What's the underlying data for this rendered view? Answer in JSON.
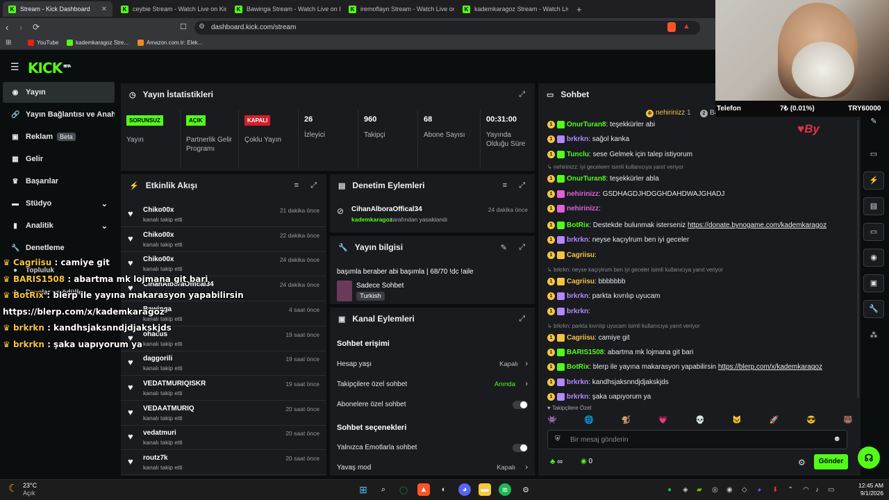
{
  "browser": {
    "tabs": [
      {
        "title": "Stream - Kick Dashboard",
        "active": true
      },
      {
        "title": "ceybie Stream - Watch Live on Kick"
      },
      {
        "title": "Bawinga Stream - Watch Live on Kick"
      },
      {
        "title": "iremoflayn Stream - Watch Live on Kick"
      },
      {
        "title": "kademkaragoz Stream - Watch Live on Kick"
      }
    ],
    "new_tab": "+",
    "url": "dashboard.kick.com/stream",
    "bookmarks": [
      "YouTube",
      "kademkaragoz Stre...",
      "Amazon.com.tr: Elek..."
    ]
  },
  "app": {
    "logo": "KICK",
    "logo_tag": "BETA",
    "sidebar": [
      {
        "label": "Yayın",
        "icon": "broadcast-icon",
        "active": true
      },
      {
        "label": "Yayın Bağlantısı ve Anahtarı",
        "icon": "link-icon"
      },
      {
        "label": "Reklam",
        "icon": "ad-icon",
        "badge": "Beta"
      },
      {
        "label": "Gelir",
        "icon": "revenue-icon"
      },
      {
        "label": "Başarılar",
        "icon": "trophy-icon"
      },
      {
        "label": "Stüdyo",
        "icon": "studio-icon",
        "chevron": true
      },
      {
        "label": "Analitik",
        "icon": "analytics-icon",
        "chevron": true
      },
      {
        "label": "Denetleme",
        "icon": "moderation-icon"
      },
      {
        "label": "Topluluk",
        "icon": "community-icon"
      },
      {
        "label": "Droplar ve ödüller",
        "icon": "drops-icon"
      }
    ]
  },
  "stats": {
    "title": "Yayın İstatistikleri",
    "items": [
      {
        "tag": "SORUNSUZ",
        "tag_color": "#53fc18",
        "label": "Yayın"
      },
      {
        "tag": "AÇIK",
        "tag_color": "#53fc18",
        "label": "Partnerlik Gelir Programı"
      },
      {
        "tag": "KAPALI",
        "tag_color": "#d0202a",
        "label": "Çoklu Yayın"
      },
      {
        "value": "26",
        "label": "İzleyici"
      },
      {
        "value": "960",
        "label": "Takipçi"
      },
      {
        "value": "68",
        "label": "Abone Sayısı"
      },
      {
        "value": "00:31:00",
        "label": "Yayında Olduğu Süre"
      }
    ]
  },
  "activity": {
    "title": "Etkinlik Akışı",
    "items": [
      {
        "name": "Chiko00x",
        "sub": "kanalı takip etti",
        "time": "21 dakika önce"
      },
      {
        "name": "Chiko00x",
        "sub": "kanalı takip etti",
        "time": "22 dakika önce"
      },
      {
        "name": "Chiko00x",
        "sub": "kanalı takip etti",
        "time": "24 dakika önce"
      },
      {
        "name": "CihanAlboraOffical34",
        "sub": "kanalı takip etti",
        "time": "24 dakika önce"
      },
      {
        "name": "Bawinga",
        "sub": "kanalı takip etti",
        "time": "4 saat önce"
      },
      {
        "name": "ohacus",
        "sub": "kanalı takip etti",
        "time": "19 saat önce"
      },
      {
        "name": "daggorili",
        "sub": "kanalı takip etti",
        "time": "19 saat önce"
      },
      {
        "name": "VEDATMURIQISKR",
        "sub": "kanalı takip etti",
        "time": "19 saat önce"
      },
      {
        "name": "VEDAATMURIQ",
        "sub": "kanalı takip etti",
        "time": "20 saat önce"
      },
      {
        "name": "vedatmuri",
        "sub": "kanalı takip etti",
        "time": "20 saat önce"
      },
      {
        "name": "routz7k",
        "sub": "kanalı takip etti",
        "time": "20 saat önce"
      }
    ]
  },
  "moderation": {
    "title": "Denetim Eylemleri",
    "item": {
      "name": "CihanAlboraOffical34",
      "time": "24 dakika önce",
      "by": "kademkaragoz",
      "action": "tarafından yasaklandı"
    }
  },
  "stream_info": {
    "title": "Yayın bilgisi",
    "stream_title": "başımla beraber abi başımla | 68/70 !dc !aile",
    "category": "Sadece Sohbet",
    "language": "Turkish"
  },
  "channel_actions": {
    "title": "Kanal Eylemleri",
    "section1": "Sohbet erişimi",
    "rows1": [
      {
        "label": "Hesap yaşı",
        "value": "Kapalı"
      },
      {
        "label": "Takipçilere özel sohbet",
        "value": "Anında"
      },
      {
        "label": "Abonelere özel sohbet",
        "value": ""
      }
    ],
    "section2": "Sohbet seçenekleri",
    "rows2": [
      {
        "label": "Yalnızca Emotlarla sohbet",
        "value": ""
      },
      {
        "label": "Yavaş mod",
        "value": "Kapalı"
      }
    ]
  },
  "chat": {
    "title": "Sohbet",
    "pinned_user": "nehirinizz",
    "pinned_count": "1",
    "pinned_user2": "Bawinga",
    "messages": [
      {
        "user": "OnurTuran8",
        "color": "#53fc18",
        "text": "teşekkürler abi"
      },
      {
        "user": "brkrkn",
        "color": "#b388ff",
        "text": "sağol kanka"
      },
      {
        "user": "Tunclu",
        "color": "#53fc18",
        "text": "sese Gelmek için talep istiyorum"
      },
      {
        "reply": "nehirinizz: iyi geceleerr isimli kullanıcıya yanıt veriyor"
      },
      {
        "user": "OnurTuran8",
        "color": "#53fc18",
        "text": "teşekkürler abla"
      },
      {
        "user": "nehirinizz",
        "color": "#e062d8",
        "text": "GSDHAGDJHDGGHDAHDWAJGHADJ"
      },
      {
        "user": "nehirinizz",
        "color": "#e062d8",
        "text": ""
      },
      {
        "user": "BotRix",
        "color": "#53fc18",
        "text": "Destekde bulunmak isterseniz",
        "link": "https://donate.bynogame.com/kademkaragoz"
      },
      {
        "user": "brkrkn",
        "color": "#b388ff",
        "text": "neyse kaçıylrum ben iyi geceler"
      },
      {
        "user": "Cagriisu",
        "color": "#f5c542",
        "text": ""
      },
      {
        "reply": "brkrkn: neyse kaçıylrum ben iyi geceler isimli kullanıcıya yanıt veriyor"
      },
      {
        "user": "Cagriisu",
        "color": "#f5c542",
        "text": "bbbbbbb"
      },
      {
        "user": "brkrkn",
        "color": "#b388ff",
        "text": "parkta kıvrılıp uyucam"
      },
      {
        "user": "brkrkn",
        "color": "#b388ff",
        "text": ""
      },
      {
        "reply": "brkrkn: parkta kıvrılıp uyucam isimli kullanıcıya yanıt veriyor"
      },
      {
        "user": "Cagriisu",
        "color": "#f5c542",
        "text": "camiye git"
      },
      {
        "user": "BARIS1508",
        "color": "#53fc18",
        "text": "abartma mk lojmana git bari"
      },
      {
        "user": "BotRix",
        "color": "#53fc18",
        "text": "blerp ile yayına makarasyon yapabilirsin",
        "link": "https://blerp.com/x/kademkaragoz"
      },
      {
        "user": "brkrkn",
        "color": "#b388ff",
        "text": "kandhsjaksnndjdjakskjds"
      },
      {
        "user": "brkrkn",
        "color": "#b388ff",
        "text": "şaka uapıyorum ya"
      }
    ],
    "followers_only": "Takipçilere Özel",
    "input_placeholder": "Bir mesaj gönderin",
    "counter1": "∞",
    "counter2": "0",
    "send": "Gönder"
  },
  "webcam": {
    "ticker_label": "Telefon",
    "ticker_change": "7₺ (0.01%)",
    "ticker_value": "TRY60000"
  },
  "overlay_chat": [
    {
      "user": "Cagriisu",
      "text": ": camiye git"
    },
    {
      "user": "BARIS1508",
      "text": ": abartma mk lojmana git bari"
    },
    {
      "user": "BotRix",
      "text": ": blerp ile yayına makarasyon yapabilirsin"
    },
    {
      "user": "",
      "text": "https://blerp.com/x/kademkaragoz"
    },
    {
      "user": "brkrkn",
      "text": ": kandhsjaksnndjdjakskjds"
    },
    {
      "user": "brkrkn",
      "text": ": şaka uapıyorum ya"
    }
  ],
  "taskbar": {
    "weather_temp": "23°C",
    "weather_text": "Açık",
    "time": "12:45 AM",
    "date": "9/1/2026"
  }
}
